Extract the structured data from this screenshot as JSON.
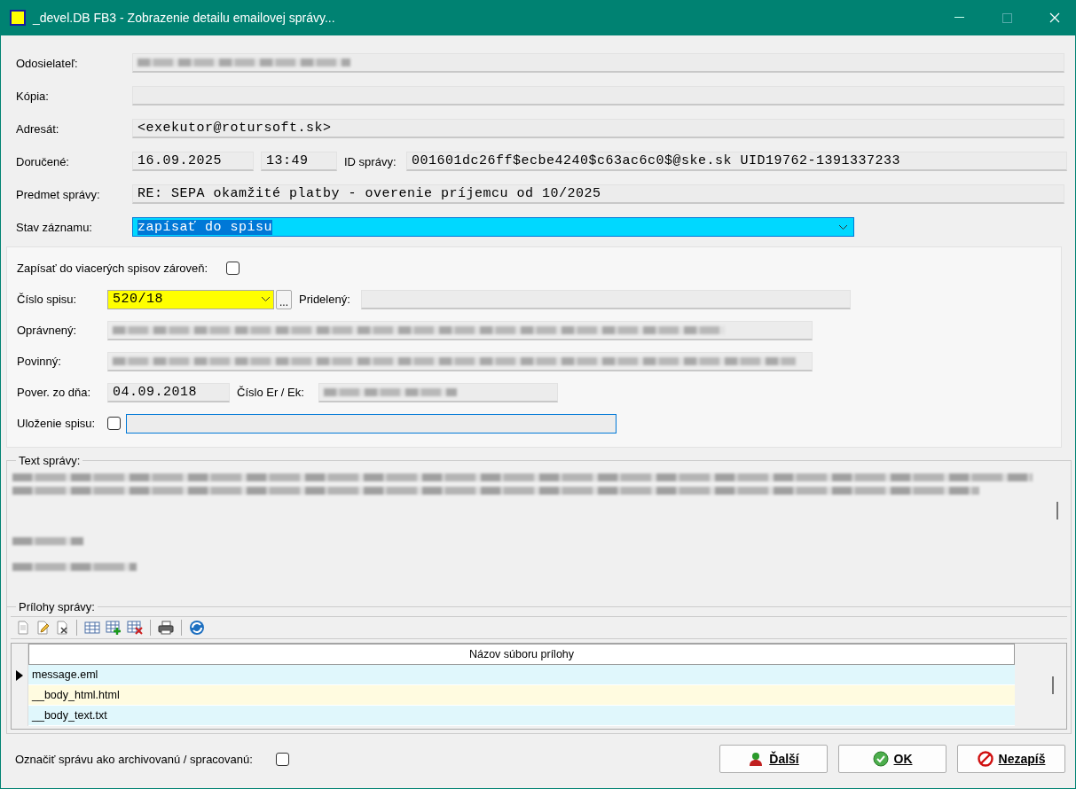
{
  "window": {
    "title": "_devel.DB FB3 - Zobrazenie detailu emailovej správy..."
  },
  "sender": {
    "label": "Odosielateľ:",
    "redacted": true
  },
  "copy": {
    "label": "Kópia:"
  },
  "recipient": {
    "label": "Adresát:",
    "value": "<exekutor@rotursoft.sk>"
  },
  "delivered": {
    "label": "Doručené:",
    "date": "16.09.2025",
    "time": "13:49",
    "id_label": "ID správy:",
    "id_value": "001601dc26ff$ecbe4240$c63ac6c0$@ske.sk UID19762-1391337233"
  },
  "subject": {
    "label": "Predmet správy:",
    "value": "RE: SEPA okamžité platby - overenie príjemcu od 10/2025"
  },
  "record_state": {
    "label": "Stav záznamu:",
    "value": "zapísať do spisu",
    "highlighted": true
  },
  "case": {
    "multi_label": "Zapísať do viacerých spisov zároveň:",
    "multi_checked": false,
    "number_label": "Číslo spisu:",
    "number_value": "520/18",
    "more_button": "...",
    "assigned_label": "Pridelený:",
    "entitled_label": "Oprávnený:",
    "entitled_redacted": true,
    "obliged_label": "Povinný:",
    "obliged_redacted": true,
    "authorized_label": "Pover. zo dňa:",
    "authorized_date": "04.09.2018",
    "er_label": "Číslo Er / Ek:",
    "er_redacted": true,
    "storage_label": "Uloženie spisu:",
    "storage_checked": false
  },
  "message": {
    "label": "Text správy:",
    "redacted": true
  },
  "attachments": {
    "label": "Prílohy správy:",
    "column": "Názov súboru prílohy",
    "rows": [
      {
        "name": "message.eml",
        "current": true,
        "color": "#e0f7fc"
      },
      {
        "name": "__body_html.html",
        "current": false,
        "color": "#fffbe0"
      },
      {
        "name": "__body_text.txt",
        "current": false,
        "color": "#e0f7fc"
      }
    ]
  },
  "archive": {
    "label": "Označiť správu ako archivovanú / spracovanú:",
    "checked": false
  },
  "buttons": [
    {
      "label": "Ďalší",
      "kind": "next"
    },
    {
      "label": "OK",
      "kind": "ok"
    },
    {
      "label": "Nezapíš",
      "kind": "cancel"
    }
  ]
}
